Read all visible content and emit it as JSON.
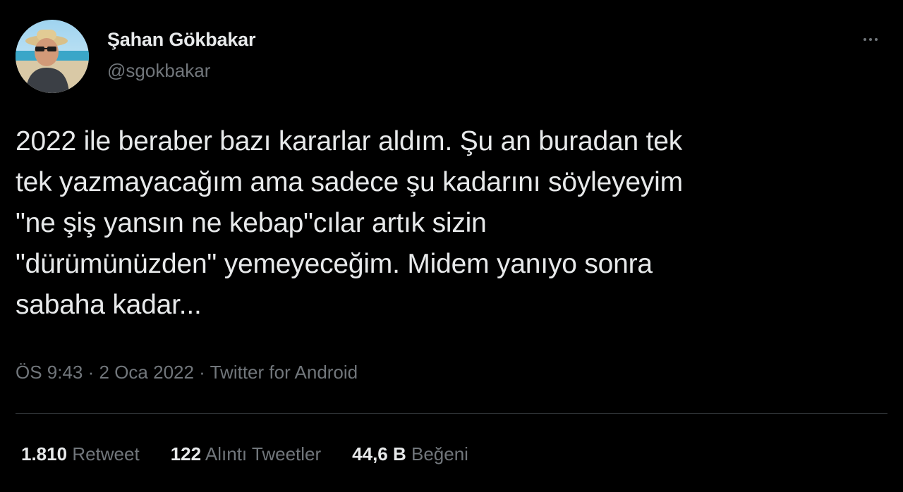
{
  "author": {
    "display_name": "Şahan Gökbakar",
    "handle": "@sgokbakar"
  },
  "more_icon": "more-horizontal-icon",
  "tweet": {
    "text": "2022 ile beraber bazı kararlar aldım. Şu an buradan tek\ntek yazmayacağım ama sadece şu kadarını söyleyeyim\n\"ne şiş yansın ne kebap\"cılar artık sizin\n\"dürümünüzden\" yemeyeceğim. Midem yanıyo sonra\nsabaha kadar..."
  },
  "meta": {
    "time": "ÖS 9:43",
    "sep1": " · ",
    "date": "2 Oca 2022",
    "sep2": " · ",
    "source": "Twitter for Android"
  },
  "stats": [
    {
      "value": "1.810",
      "label": "Retweet"
    },
    {
      "value": "122",
      "label": "Alıntı Tweetler"
    },
    {
      "value": "44,6 B",
      "label": "Beğeni"
    }
  ],
  "colors": {
    "background": "#000000",
    "primary_text": "#e7e9ea",
    "secondary_text": "#71767b",
    "divider": "#2f3336"
  }
}
